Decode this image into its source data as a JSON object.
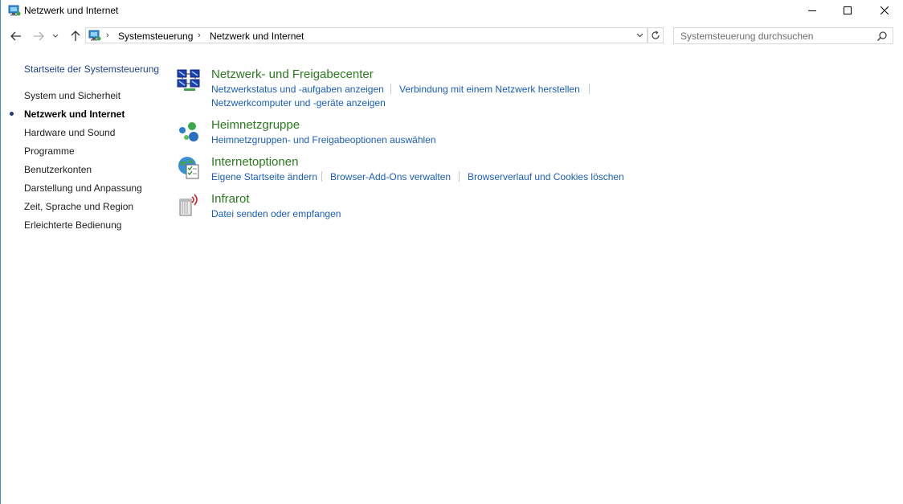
{
  "window": {
    "title": "Netzwerk und Internet"
  },
  "address": {
    "crumbs": [
      "Systemsteuerung",
      "Netzwerk und Internet"
    ]
  },
  "search": {
    "placeholder": "Systemsteuerung durchsuchen"
  },
  "sidebar": {
    "home": "Startseite der Systemsteuerung",
    "items": [
      {
        "label": "System und Sicherheit",
        "active": false
      },
      {
        "label": "Netzwerk und Internet",
        "active": true
      },
      {
        "label": "Hardware und Sound",
        "active": false
      },
      {
        "label": "Programme",
        "active": false
      },
      {
        "label": "Benutzerkonten",
        "active": false
      },
      {
        "label": "Darstellung und Anpassung",
        "active": false
      },
      {
        "label": "Zeit, Sprache und Region",
        "active": false
      },
      {
        "label": "Erleichterte Bedienung",
        "active": false
      }
    ]
  },
  "categories": [
    {
      "title": "Netzwerk- und Freigabecenter",
      "icon": "network-sharing-center-icon",
      "links": [
        "Netzwerkstatus und -aufgaben anzeigen",
        "Verbindung mit einem Netzwerk herstellen",
        "Netzwerkcomputer und -geräte anzeigen"
      ]
    },
    {
      "title": "Heimnetzgruppe",
      "icon": "homegroup-icon",
      "links": [
        "Heimnetzgruppen- und Freigabeoptionen auswählen"
      ]
    },
    {
      "title": "Internetoptionen",
      "icon": "internet-options-icon",
      "links": [
        "Eigene Startseite ändern",
        "Browser-Add-Ons verwalten",
        "Browserverlauf und Cookies löschen"
      ]
    },
    {
      "title": "Infrarot",
      "icon": "infrared-icon",
      "links": [
        "Datei senden oder empfangen"
      ]
    }
  ],
  "colors": {
    "category_title": "#2a7a1e",
    "link": "#1a5dbf",
    "window_border": "#3f8fd6"
  }
}
